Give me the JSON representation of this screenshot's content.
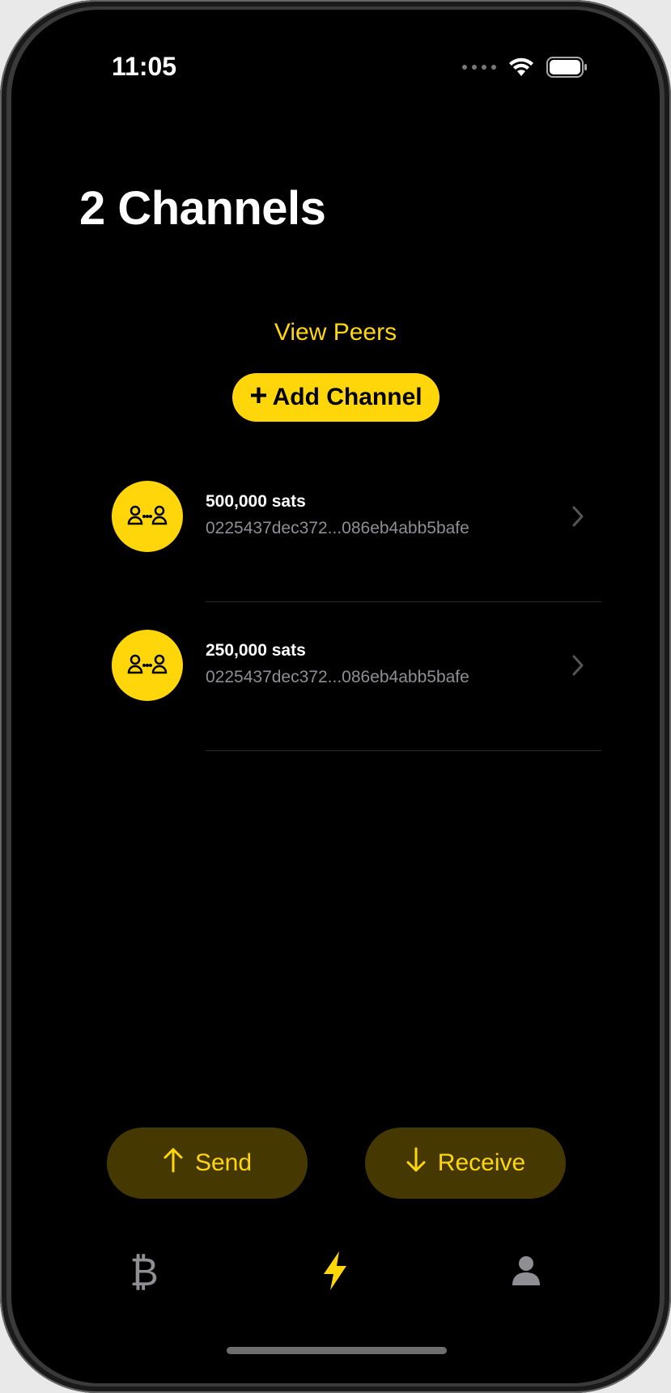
{
  "status_bar": {
    "time": "11:05"
  },
  "header": {
    "title": "2 Channels"
  },
  "actions": {
    "view_peers": "View Peers",
    "add_channel": "Add Channel"
  },
  "channels": [
    {
      "amount": "500,000 sats",
      "node_id": "0225437dec372...086eb4abb5bafe"
    },
    {
      "amount": "250,000 sats",
      "node_id": "0225437dec372...086eb4abb5bafe"
    }
  ],
  "bottom_actions": {
    "send": "Send",
    "receive": "Receive"
  },
  "tab_bar": {
    "tabs": [
      {
        "icon": "bitcoin-icon",
        "glyph": "₿",
        "selected": false
      },
      {
        "icon": "lightning-icon",
        "selected": true
      },
      {
        "icon": "person-icon",
        "selected": false
      }
    ]
  },
  "colors": {
    "accent": "#ffd60a",
    "background": "#000000",
    "muted": "#8e8e93",
    "button_bg": "#453800"
  }
}
